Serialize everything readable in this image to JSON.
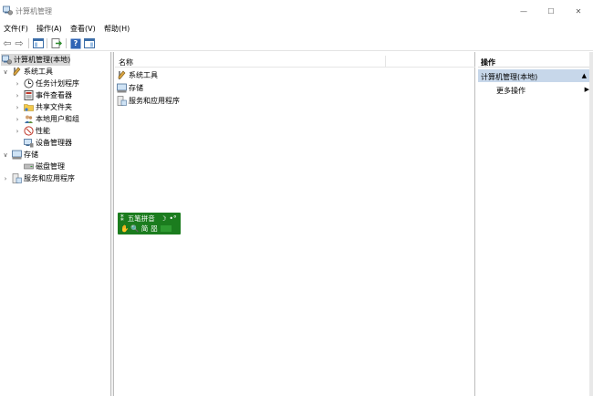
{
  "window": {
    "title": "计算机管理",
    "minimize_glyph": "—",
    "maximize_glyph": "☐",
    "close_glyph": "✕"
  },
  "menu": {
    "file": "文件(F)",
    "action": "操作(A)",
    "view": "查看(V)",
    "help": "帮助(H)"
  },
  "toolbar": {
    "back_glyph": "⇦",
    "forward_glyph": "⇨",
    "help_glyph": "?"
  },
  "tree": {
    "root": "计算机管理(本地)",
    "system_tools": "系统工具",
    "task_scheduler": "任务计划程序",
    "event_viewer": "事件查看器",
    "shared_folders": "共享文件夹",
    "local_users": "本地用户和组",
    "performance": "性能",
    "device_manager": "设备管理器",
    "storage": "存储",
    "disk_management": "磁盘管理",
    "services_apps": "服务和应用程序",
    "expanded_glyph": "∨",
    "collapsed_glyph": "›"
  },
  "list": {
    "column_name": "名称",
    "rows": [
      "系统工具",
      "存储",
      "服务和应用程序"
    ]
  },
  "actions": {
    "header": "操作",
    "group": "计算机管理(本地)",
    "group_glyph": "▲",
    "more": "更多操作",
    "more_glyph": "▶"
  },
  "ime": {
    "name": "五笔拼音",
    "moon_glyph": "☽",
    "punct_glyph": "•°",
    "hand_glyph": "✋",
    "search_glyph": "🔍",
    "mode": "简",
    "width_mode": "㗊"
  },
  "colors": {
    "ime_green": "#1b7c1e",
    "selection_blue": "#c7d7ea"
  }
}
